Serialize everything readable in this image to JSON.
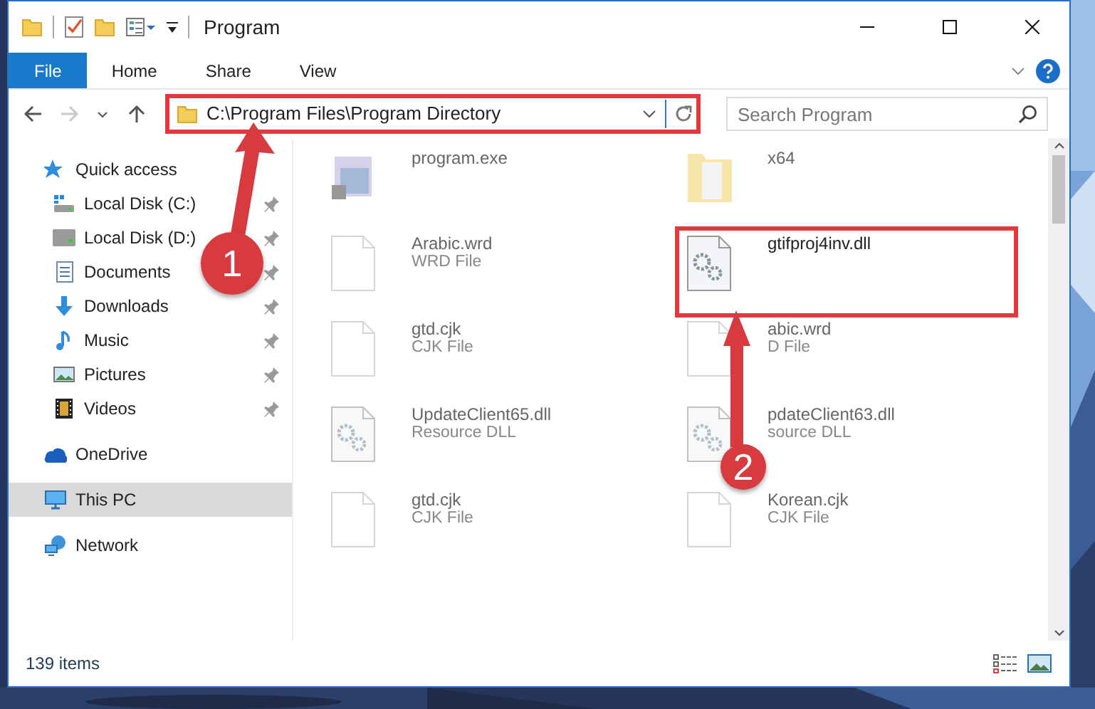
{
  "window": {
    "title": "Program"
  },
  "ribbon_tabs": [
    {
      "label": "File",
      "selected": true
    },
    {
      "label": "Home",
      "selected": false
    },
    {
      "label": "Share",
      "selected": false
    },
    {
      "label": "View",
      "selected": false
    }
  ],
  "navigation": {
    "forward_disabled": true
  },
  "address_bar": {
    "path": "C:\\Program Files\\Program Directory",
    "highlighted": true
  },
  "search": {
    "placeholder": "Search Program"
  },
  "sidebar": {
    "items": [
      {
        "label": "Quick access",
        "selected": false,
        "children": [
          {
            "label": "Local Disk (C:)",
            "pinned": true,
            "selected": false
          },
          {
            "label": "Local Disk (D:)",
            "pinned": true,
            "selected": false
          },
          {
            "label": "Documents",
            "pinned": true,
            "selected": false
          },
          {
            "label": "Downloads",
            "pinned": true,
            "selected": false
          },
          {
            "label": "Music",
            "pinned": true,
            "selected": false
          },
          {
            "label": "Pictures",
            "pinned": true,
            "selected": false
          },
          {
            "label": "Videos",
            "pinned": true,
            "selected": false
          }
        ]
      },
      {
        "label": "OneDrive",
        "selected": false
      },
      {
        "label": "This PC",
        "selected": true
      },
      {
        "label": "Network",
        "selected": false
      }
    ]
  },
  "files": [
    {
      "kind": "program",
      "name": "program.exe",
      "blurred": true,
      "highlighted": false
    },
    {
      "kind": "folder",
      "name": "x64",
      "blurred": true,
      "highlighted": false
    },
    {
      "kind": "file",
      "name": "Arabic.wrd",
      "type": "WRD File",
      "blurred": true,
      "highlighted": false
    },
    {
      "kind": "dll",
      "name": "gtifproj4inv.dll",
      "blurred": false,
      "highlighted": true
    },
    {
      "kind": "file",
      "name": "gtd.cjk",
      "type": "CJK File",
      "blurred": true,
      "highlighted": false
    },
    {
      "kind": "file",
      "name": "abic.wrd",
      "type": "D File",
      "blurred": true,
      "highlighted": false
    },
    {
      "kind": "dll",
      "name": "UpdateClient65.dll",
      "type": "Resource DLL",
      "blurred": true,
      "highlighted": false
    },
    {
      "kind": "dll",
      "name": "pdateClient63.dll",
      "type": "source DLL",
      "blurred": true,
      "highlighted": false
    },
    {
      "kind": "file",
      "name": "gtd.cjk",
      "type": "CJK File",
      "blurred": true,
      "highlighted": false
    },
    {
      "kind": "file",
      "name": "Korean.cjk",
      "type": "CJK File",
      "blurred": true,
      "highlighted": false
    }
  ],
  "status_bar": {
    "item_count": "139 items"
  },
  "annotations": [
    {
      "number": "1"
    },
    {
      "number": "2"
    }
  ]
}
